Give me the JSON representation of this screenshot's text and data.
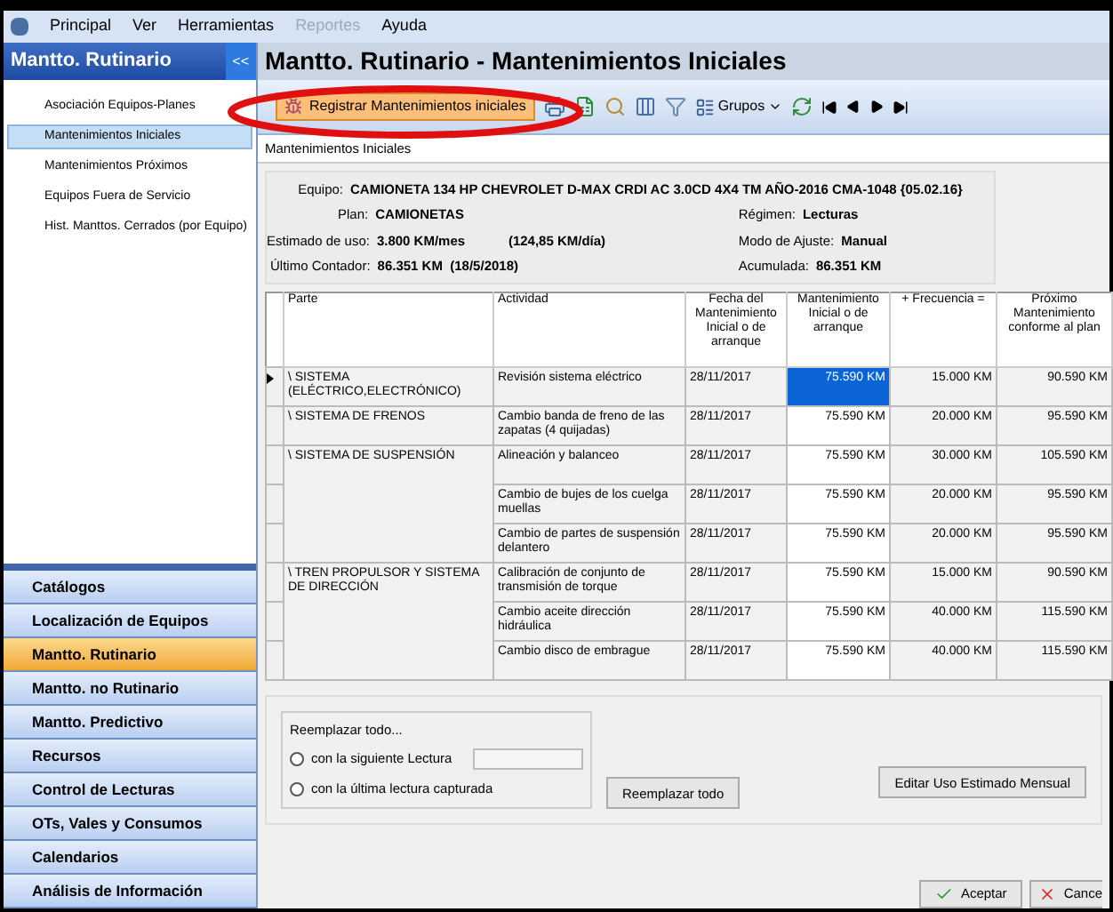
{
  "menu": [
    {
      "label": "Principal",
      "disabled": false
    },
    {
      "label": "Ver",
      "disabled": false
    },
    {
      "label": "Herramientas",
      "disabled": false
    },
    {
      "label": "Reportes",
      "disabled": true
    },
    {
      "label": "Ayuda",
      "disabled": false
    }
  ],
  "sidebar": {
    "title": "Mantto. Rutinario",
    "collapse": "<<",
    "items": [
      {
        "label": "Asociación Equipos-Planes",
        "selected": false
      },
      {
        "label": "Mantenimientos Iniciales",
        "selected": true
      },
      {
        "label": "Mantenimientos Próximos",
        "selected": false
      },
      {
        "label": "Equipos Fuera de Servicio",
        "selected": false
      },
      {
        "label": "Hist. Manttos. Cerrados (por Equipo)",
        "selected": false
      }
    ],
    "nav": [
      {
        "label": "Catálogos",
        "selected": false
      },
      {
        "label": "Localización de Equipos",
        "selected": false
      },
      {
        "label": "Mantto. Rutinario",
        "selected": true
      },
      {
        "label": "Mantto. no Rutinario",
        "selected": false
      },
      {
        "label": "Mantto. Predictivo",
        "selected": false
      },
      {
        "label": "Recursos",
        "selected": false
      },
      {
        "label": "Control de Lecturas",
        "selected": false
      },
      {
        "label": "OTs, Vales y Consumos",
        "selected": false
      },
      {
        "label": "Calendarios",
        "selected": false
      },
      {
        "label": "Análisis de Información",
        "selected": false
      }
    ]
  },
  "title": "Mantto. Rutinario - Mantenimientos Iniciales",
  "toolbar": {
    "register": "Registrar Mantenimientos iniciales",
    "groups": "Grupos"
  },
  "breadcrumb": "Mantenimientos Iniciales",
  "info": {
    "equipo_label": "Equipo:",
    "equipo": "CAMIONETA 134 HP CHEVROLET D-MAX CRDI AC 3.0CD 4X4 TM AÑO-2016 CMA-1048 {05.02.16}",
    "plan_label": "Plan:",
    "plan": "CAMIONETAS",
    "regimen_label": "Régimen:",
    "regimen": "Lecturas",
    "estimado_label": "Estimado de uso:",
    "estimado": "3.800 KM/mes",
    "diario": "(124,85 KM/día)",
    "modo_label": "Modo de Ajuste:",
    "modo": "Manual",
    "ultimo_label": "Último Contador:",
    "ultimo": "86.351 KM  (18/5/2018)",
    "acumulada_label": "Acumulada:",
    "acumulada": "86.351 KM"
  },
  "table": {
    "columns": [
      "Parte",
      "Actividad",
      "Fecha del Mantenimiento Inicial o de arranque",
      "Mantenimiento Inicial o de arranque",
      "+ Frecuencia =",
      "Próximo Mantenimiento conforme al plan"
    ],
    "parts": [
      {
        "name": "\\ SISTEMA (ELÉCTRICO,ELECTRÓNICO)",
        "children": [
          {
            "activity": "Revisión sistema eléctrico",
            "date": "28/11/2017",
            "initial": "75.590 KM",
            "frequency": "15.000 KM",
            "next": "90.590 KM",
            "selected": true
          }
        ]
      },
      {
        "name": "\\ SISTEMA DE FRENOS",
        "children": [
          {
            "activity": "Cambio banda de freno de las zapatas (4 quijadas)",
            "date": "28/11/2017",
            "initial": "75.590 KM",
            "frequency": "20.000 KM",
            "next": "95.590 KM",
            "selected": false
          }
        ]
      },
      {
        "name": "\\ SISTEMA DE SUSPENSIÓN",
        "children": [
          {
            "activity": "Alineación y balanceo",
            "date": "28/11/2017",
            "initial": "75.590 KM",
            "frequency": "30.000 KM",
            "next": "105.590 KM",
            "selected": false
          },
          {
            "activity": "Cambio de bujes de los cuelga muellas",
            "date": "28/11/2017",
            "initial": "75.590 KM",
            "frequency": "20.000 KM",
            "next": "95.590 KM",
            "selected": false
          },
          {
            "activity": "Cambio de partes de suspensión delantero",
            "date": "28/11/2017",
            "initial": "75.590 KM",
            "frequency": "20.000 KM",
            "next": "95.590 KM",
            "selected": false
          }
        ]
      },
      {
        "name": "\\ TREN PROPULSOR Y SISTEMA DE DIRECCIÓN",
        "children": [
          {
            "activity": "Calibración de conjunto de transmisión de torque",
            "date": "28/11/2017",
            "initial": "75.590 KM",
            "frequency": "15.000 KM",
            "next": "90.590 KM",
            "selected": false
          },
          {
            "activity": "Cambio aceite dirección hidráulica",
            "date": "28/11/2017",
            "initial": "75.590 KM",
            "frequency": "40.000 KM",
            "next": "115.590 KM",
            "selected": false
          },
          {
            "activity": "Cambio disco de embrague",
            "date": "28/11/2017",
            "initial": "75.590 KM",
            "frequency": "40.000 KM",
            "next": "115.590 KM",
            "selected": false
          }
        ]
      }
    ]
  },
  "replace": {
    "title": "Reemplazar todo...",
    "options": [
      {
        "label": "con la siguiente Lectura",
        "selected": false,
        "kind": "input"
      },
      {
        "label": "con la última lectura capturada",
        "selected": false,
        "kind": "plain"
      }
    ],
    "button": "Reemplazar todo",
    "edit_button": "Editar Uso Estimado Mensual"
  },
  "footer": {
    "accept": "Aceptar",
    "cancel": "Cance"
  }
}
